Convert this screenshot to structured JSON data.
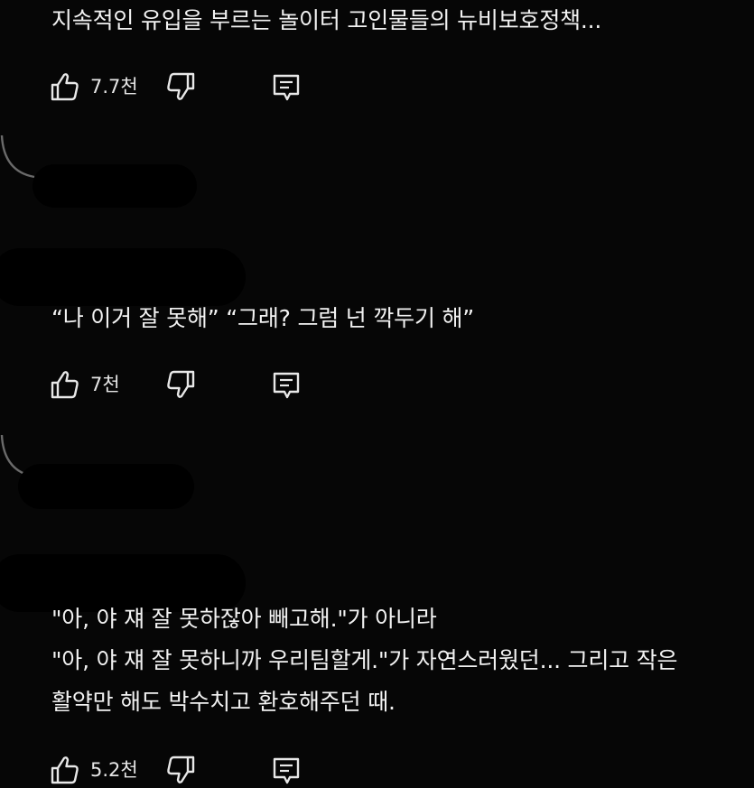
{
  "comments": [
    {
      "lines": [
        "지속적인 유입을 부르는 놀이터 고인물들의 뉴비보호정책..."
      ],
      "likes": "7.7천"
    },
    {
      "lines": [
        "“나 이거 잘 못해” “그래? 그럼 넌 깍두기 해”"
      ],
      "likes": "7천"
    },
    {
      "lines": [
        "\"아, 야 쟤 잘 못하잖아 빼고해.\"가 아니라",
        "\"아, 야 쟤 잘 못하니까 우리팀할게.\"가 자연스러웠던... 그리고 작은",
        "활약만 해도 박수치고 환호해주던 때."
      ],
      "likes": "5.2천"
    }
  ],
  "icons": {
    "like": "thumbs-up-icon",
    "dislike": "thumbs-down-icon",
    "reply": "comment-icon"
  },
  "colors": {
    "background": "#060606",
    "text": "#f2f2f2",
    "icon": "#e8e8e8"
  }
}
